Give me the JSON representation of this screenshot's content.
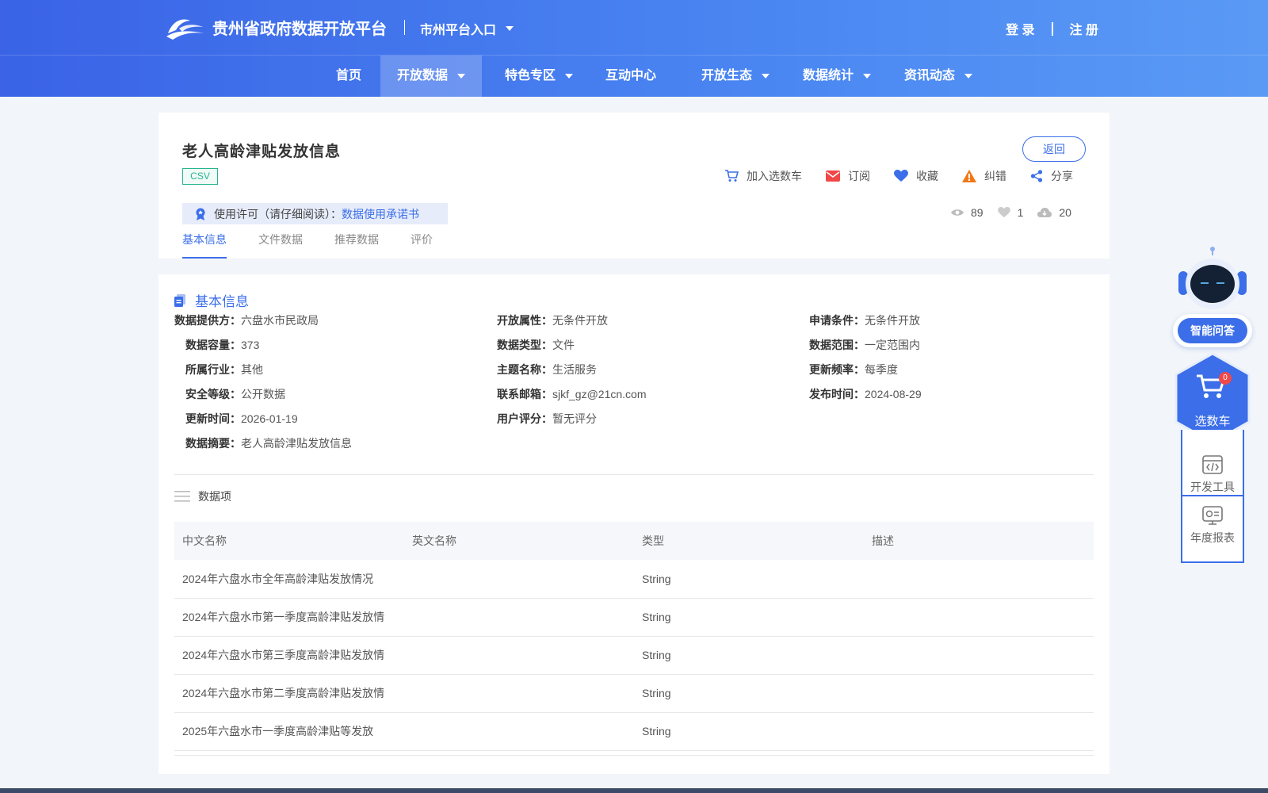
{
  "header": {
    "site_name": "贵州省政府数据开放平台",
    "city_entry": "市州平台入口",
    "login": "登 录",
    "register": "注 册"
  },
  "nav": [
    {
      "label": "首页",
      "dropdown": false,
      "active": false
    },
    {
      "label": "开放数据",
      "dropdown": true,
      "active": true
    },
    {
      "label": "特色专区",
      "dropdown": true,
      "active": false
    },
    {
      "label": "互动中心",
      "dropdown": false,
      "active": false
    },
    {
      "label": "开放生态",
      "dropdown": true,
      "active": false
    },
    {
      "label": "数据统计",
      "dropdown": true,
      "active": false
    },
    {
      "label": "资讯动态",
      "dropdown": true,
      "active": false
    }
  ],
  "dataset": {
    "title": "老人高龄津贴发放信息",
    "format": "CSV",
    "back": "返回",
    "actions": {
      "cart": "加入选数车",
      "subscribe": "订阅",
      "favorite": "收藏",
      "report": "纠错",
      "share": "分享"
    },
    "license_label": "使用许可（请仔细阅读）：",
    "license_link": "数据使用承诺书",
    "stats": {
      "views": "89",
      "likes": "1",
      "downloads": "20"
    },
    "tabs": [
      "基本信息",
      "文件数据",
      "推荐数据",
      "评价"
    ]
  },
  "basic_info": {
    "heading": "基本信息",
    "fields": [
      {
        "label": "数据提供方：",
        "value": "六盘水市民政局"
      },
      {
        "label": "开放属性：",
        "value": "无条件开放"
      },
      {
        "label": "申请条件：",
        "value": "无条件开放"
      },
      {
        "label": "数据容量：",
        "value": "373"
      },
      {
        "label": "数据类型：",
        "value": "文件"
      },
      {
        "label": "数据范围：",
        "value": "一定范围内"
      },
      {
        "label": "所属行业：",
        "value": "其他"
      },
      {
        "label": "主题名称：",
        "value": "生活服务"
      },
      {
        "label": "更新频率：",
        "value": "每季度"
      },
      {
        "label": "安全等级：",
        "value": "公开数据"
      },
      {
        "label": "联系邮箱：",
        "value": "sjkf_gz@21cn.com"
      },
      {
        "label": "发布时间：",
        "value": "2024-08-29"
      },
      {
        "label": "更新时间：",
        "value": "2026-01-19"
      },
      {
        "label": "用户评分：",
        "value": "暂无评分"
      },
      {
        "label": "数据摘要：",
        "value": "老人高龄津贴发放信息"
      }
    ]
  },
  "data_items": {
    "heading": "数据项",
    "columns": [
      "中文名称",
      "英文名称",
      "类型",
      "描述"
    ],
    "rows": [
      [
        "2024年六盘水市全年高龄津贴发放情况",
        "",
        "String",
        ""
      ],
      [
        "2024年六盘水市第一季度高龄津贴发放情",
        "",
        "String",
        ""
      ],
      [
        "2024年六盘水市第三季度高龄津贴发放情",
        "",
        "String",
        ""
      ],
      [
        "2024年六盘水市第二季度高龄津贴发放情",
        "",
        "String",
        ""
      ],
      [
        "2025年六盘水市一季度高龄津贴等发放",
        "",
        "String",
        ""
      ]
    ]
  },
  "sidebar": {
    "ai_label": "智能问答",
    "cart_label": "选数车",
    "cart_count": "0",
    "dev_tools": "开发工具",
    "annual_report": "年度报表"
  },
  "colors": {
    "primary": "#3b6ee8",
    "header_start": "#3a63e6",
    "header_end": "#5a9af5",
    "format_green": "#26b58f"
  }
}
